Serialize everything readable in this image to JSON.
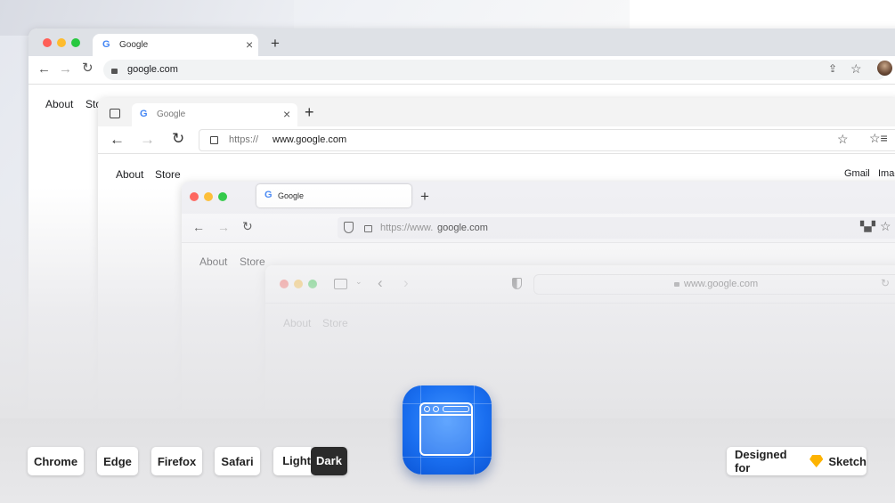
{
  "chrome": {
    "tab_title": "Google",
    "url": "google.com",
    "links": [
      "About",
      "Sto"
    ]
  },
  "edge": {
    "tab_title": "Google",
    "url_scheme": "https://",
    "url_host": "www.google.com",
    "links": [
      "About",
      "Store"
    ],
    "right_links": [
      "Gmail",
      "Imag"
    ]
  },
  "firefox": {
    "tab_title": "Google",
    "url_scheme": "https://www.",
    "url_host": "google.com",
    "links": [
      "About",
      "Store"
    ]
  },
  "safari": {
    "url": "www.google.com",
    "links": [
      "About",
      "Store"
    ]
  },
  "bottom": {
    "buttons": [
      "Chrome",
      "Edge",
      "Firefox",
      "Safari"
    ],
    "toggle_light": "Light",
    "toggle_dark": "Dark",
    "designed_for": "Designed for",
    "sketch": "Sketch"
  },
  "icons": {
    "google": "G",
    "back": "←",
    "forward": "→",
    "reload": "↻",
    "close": "×",
    "plus": "+",
    "star": "☆",
    "lock": "🔒"
  },
  "colors": {
    "accent_blue": "#1a6ff0",
    "dark_toggle": "#2b2b2b",
    "sketch_gem": "#fdb300"
  }
}
